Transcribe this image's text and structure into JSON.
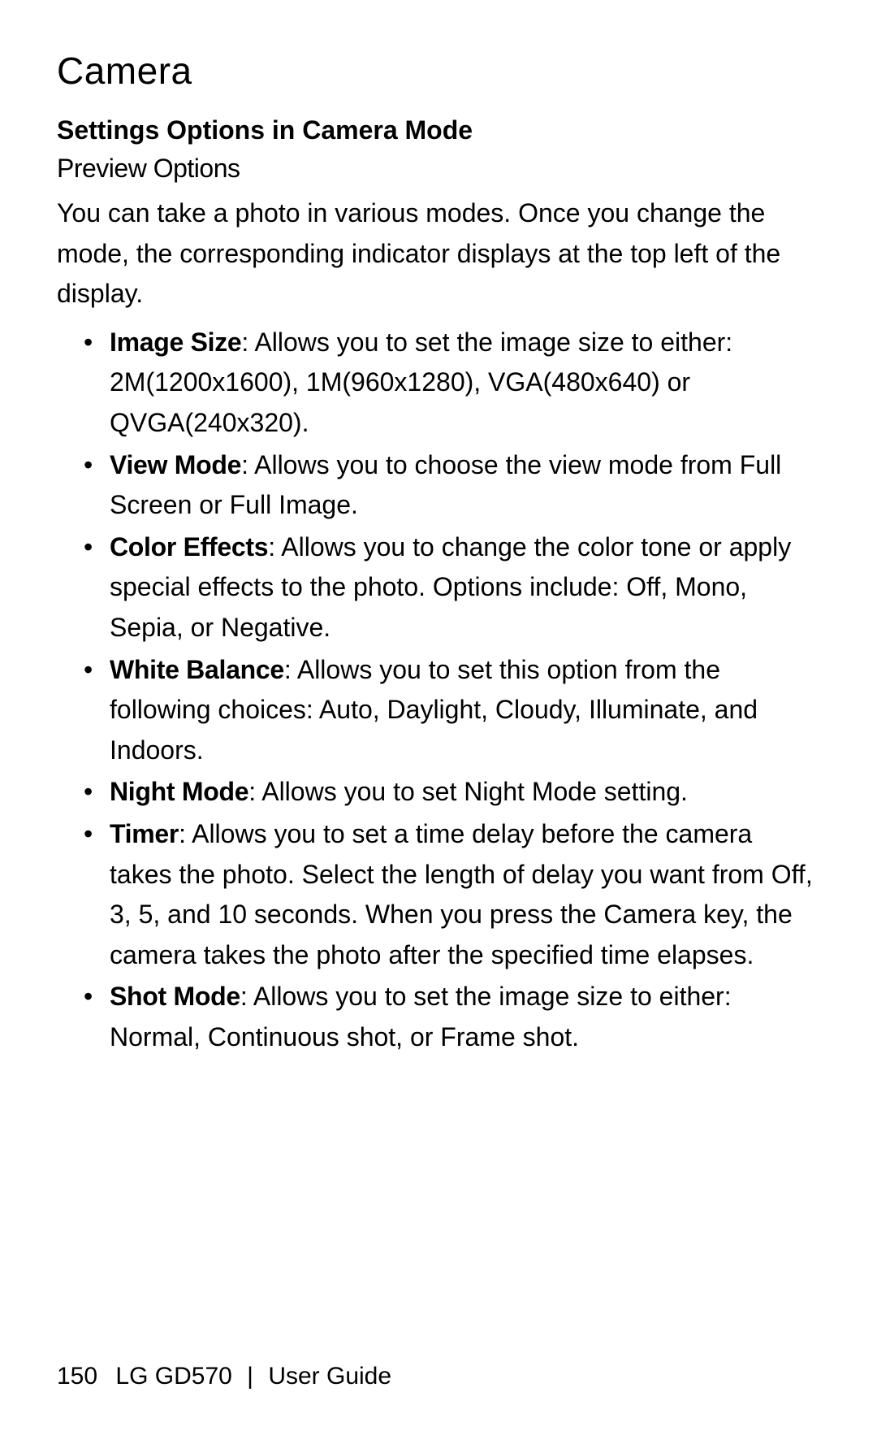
{
  "title": "Camera",
  "section_heading": "Settings Options in Camera Mode",
  "subsection_heading": "Preview Options",
  "intro": "You can take a photo in various modes. Once you change the mode, the corresponding indicator displays at the top left of the display.",
  "options": [
    {
      "name": "Image Size",
      "description": ": Allows you to set the image size to either: 2M(1200x1600), 1M(960x1280), VGA(480x640) or QVGA(240x320)."
    },
    {
      "name": "View Mode",
      "description": ": Allows you to choose the view mode from Full Screen or Full Image."
    },
    {
      "name": "Color Effects",
      "description": ": Allows you to change the color tone or apply special effects to the photo. Options include: Off, Mono, Sepia, or Negative."
    },
    {
      "name": "White Balance",
      "description": ": Allows you to set this option from the following choices: Auto, Daylight, Cloudy, Illuminate, and Indoors."
    },
    {
      "name": "Night Mode",
      "description": ": Allows you to set Night Mode setting."
    },
    {
      "name": "Timer",
      "description": ": Allows you to set a time delay before the camera takes the photo. Select the length of delay you want from Off, 3, 5, and 10 seconds. When you press the Camera key, the camera takes the photo after the specified time elapses."
    },
    {
      "name": "Shot Mode",
      "description": ": Allows you to set the image size to either: Normal, Continuous shot, or Frame shot."
    }
  ],
  "footer": {
    "page_number": "150",
    "product": "LG GD570",
    "separator": "|",
    "doc_type": "User Guide"
  }
}
